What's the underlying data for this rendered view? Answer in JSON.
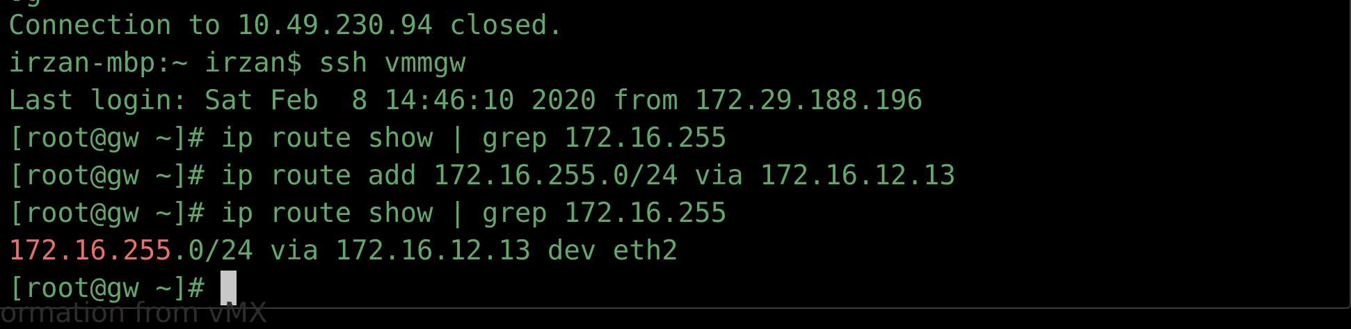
{
  "terminal": {
    "clipped_top_text": "og",
    "lines": [
      "Connection to 10.49.230.94 closed.",
      "irzan-mbp:~ irzan$ ssh vmmgw",
      "Last login: Sat Feb  8 14:46:10 2020 from 172.29.188.196",
      "[root@gw ~]# ip route show | grep 172.16.255",
      "[root@gw ~]# ip route add 172.16.255.0/24 via 172.16.12.13",
      "[root@gw ~]# ip route show | grep 172.16.255"
    ],
    "route_output": {
      "match": "172.16.255",
      "rest": ".0/24 via 172.16.12.13 dev eth2"
    },
    "prompt": "[root@gw ~]# "
  },
  "background": {
    "partial_text": "ormation from vMX"
  },
  "colors": {
    "terminal_text": "#63a86b",
    "grep_match": "#e8706b",
    "cursor": "#c8c8c8",
    "background": "#000000"
  }
}
